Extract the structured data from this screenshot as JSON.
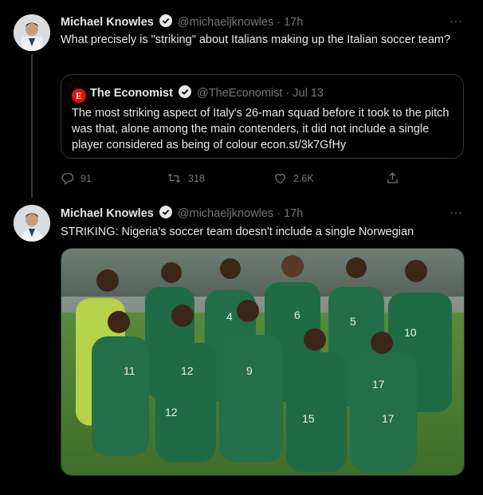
{
  "tweet1": {
    "author_name": "Michael Knowles",
    "handle": "@michaeljknowles",
    "time": "· 17h",
    "text": "What precisely is \"striking\" about Italians making up the Italian soccer team?",
    "quote": {
      "logo_letter": "E",
      "author_name": "The Economist",
      "handle": "@TheEconomist",
      "time": "· Jul 13",
      "text": "The most striking aspect of Italy's 26-man squad before it took to the pitch was that, alone among the main contenders, it did not include a single player considered as being of colour  econ.st/3k7GfHy"
    },
    "actions": {
      "replies": "91",
      "retweets": "318",
      "likes": "2.6K"
    }
  },
  "tweet2": {
    "author_name": "Michael Knowles",
    "handle": "@michaeljknowles",
    "time": "· 17h",
    "text": "STRIKING: Nigeria's soccer team doesn't include a single Norwegian",
    "jersey_numbers": [
      "4",
      "6",
      "5",
      "10",
      "11",
      "12",
      "9",
      "15",
      "17",
      "12",
      "17"
    ]
  },
  "colors": {
    "background": "#000000",
    "muted": "#71767b",
    "verified": "#1d9bf0",
    "jersey_green": "#1f6b45"
  },
  "more_label": "···"
}
